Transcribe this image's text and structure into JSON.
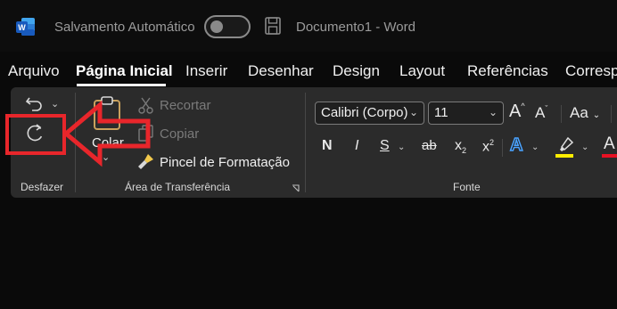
{
  "titlebar": {
    "autosave_label": "Salvamento Automático",
    "document_title": "Documento1  -  Word"
  },
  "tabs": [
    "Arquivo",
    "Página Inicial",
    "Inserir",
    "Desenhar",
    "Design",
    "Layout",
    "Referências",
    "Corresp"
  ],
  "active_tab": "Página Inicial",
  "ribbon": {
    "undo_group_label": "Desfazer",
    "clipboard": {
      "paste_label": "Colar",
      "cut_label": "Recortar",
      "copy_label": "Copiar",
      "format_painter_label": "Pincel de Formatação",
      "group_label": "Área de Transferência"
    },
    "font": {
      "font_name": "Calibri (Corpo)",
      "font_size": "11",
      "change_case_label": "Aa",
      "bold": "N",
      "italic": "I",
      "underline": "S",
      "strikethrough": "ab",
      "subscript": "x",
      "subscript_mark": "2",
      "superscript": "x",
      "superscript_mark": "2",
      "group_label": "Fonte"
    }
  },
  "colors": {
    "annotation_red": "#e8262b",
    "highlight_yellow": "#ffee00",
    "font_color_red": "#e81123",
    "word_blue": "#2b7cd3"
  }
}
